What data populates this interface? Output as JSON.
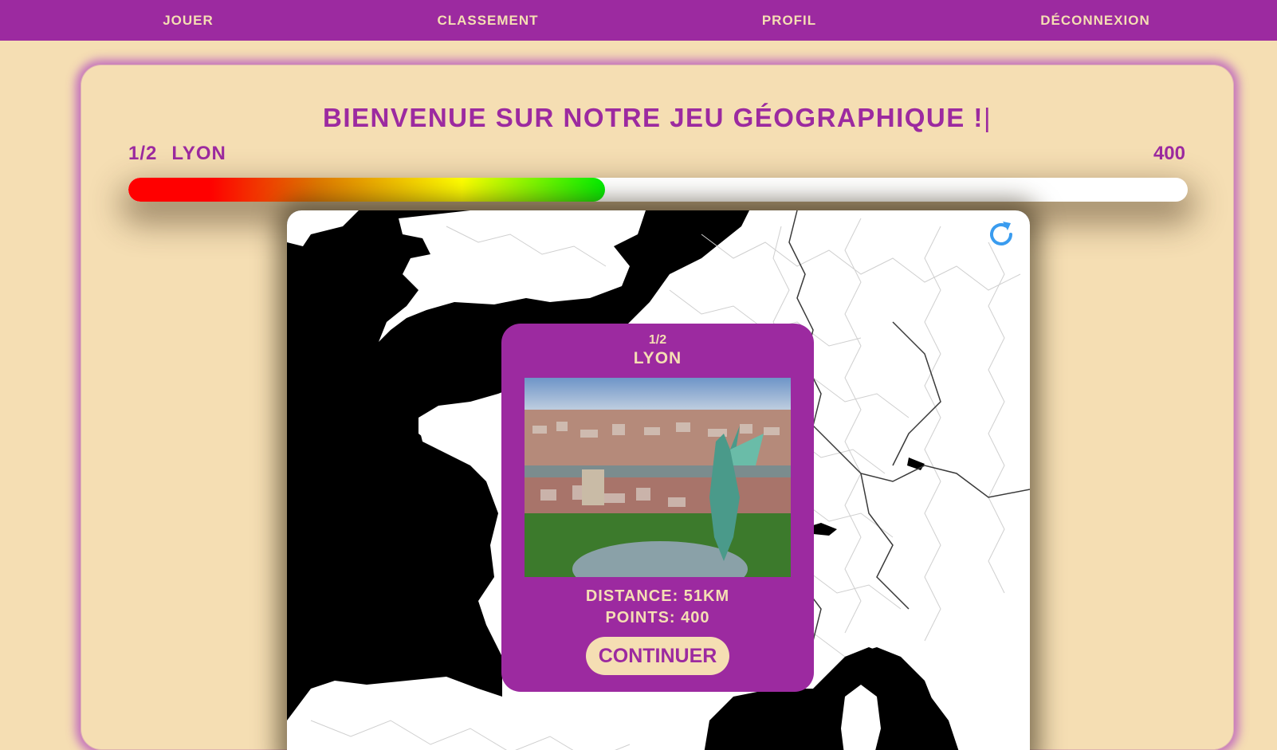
{
  "nav": {
    "items": [
      "JOUER",
      "CLASSEMENT",
      "PROFIL",
      "DÉCONNEXION"
    ]
  },
  "header": {
    "title": "BIENVENUE SUR NOTRE JEU GÉOGRAPHIQUE !",
    "caret": "|"
  },
  "game": {
    "round": "1/2",
    "city": "LYON",
    "score": "400",
    "progress_fraction": 0.45
  },
  "result": {
    "round": "1/2",
    "city": "LYON",
    "distance": "DISTANCE: 51KM",
    "points": "POINTS: 400",
    "continue_label": "CONTINUER",
    "photo": "lyon-aerial-photo"
  },
  "map": {
    "refresh_icon": "refresh-icon",
    "land_color": "#ffffff",
    "sea_color": "#000000",
    "border_color": "#cfcfcf"
  },
  "colors": {
    "accent": "#9c2aa0",
    "background": "#f5deb3",
    "refresh": "#3a9cef"
  }
}
